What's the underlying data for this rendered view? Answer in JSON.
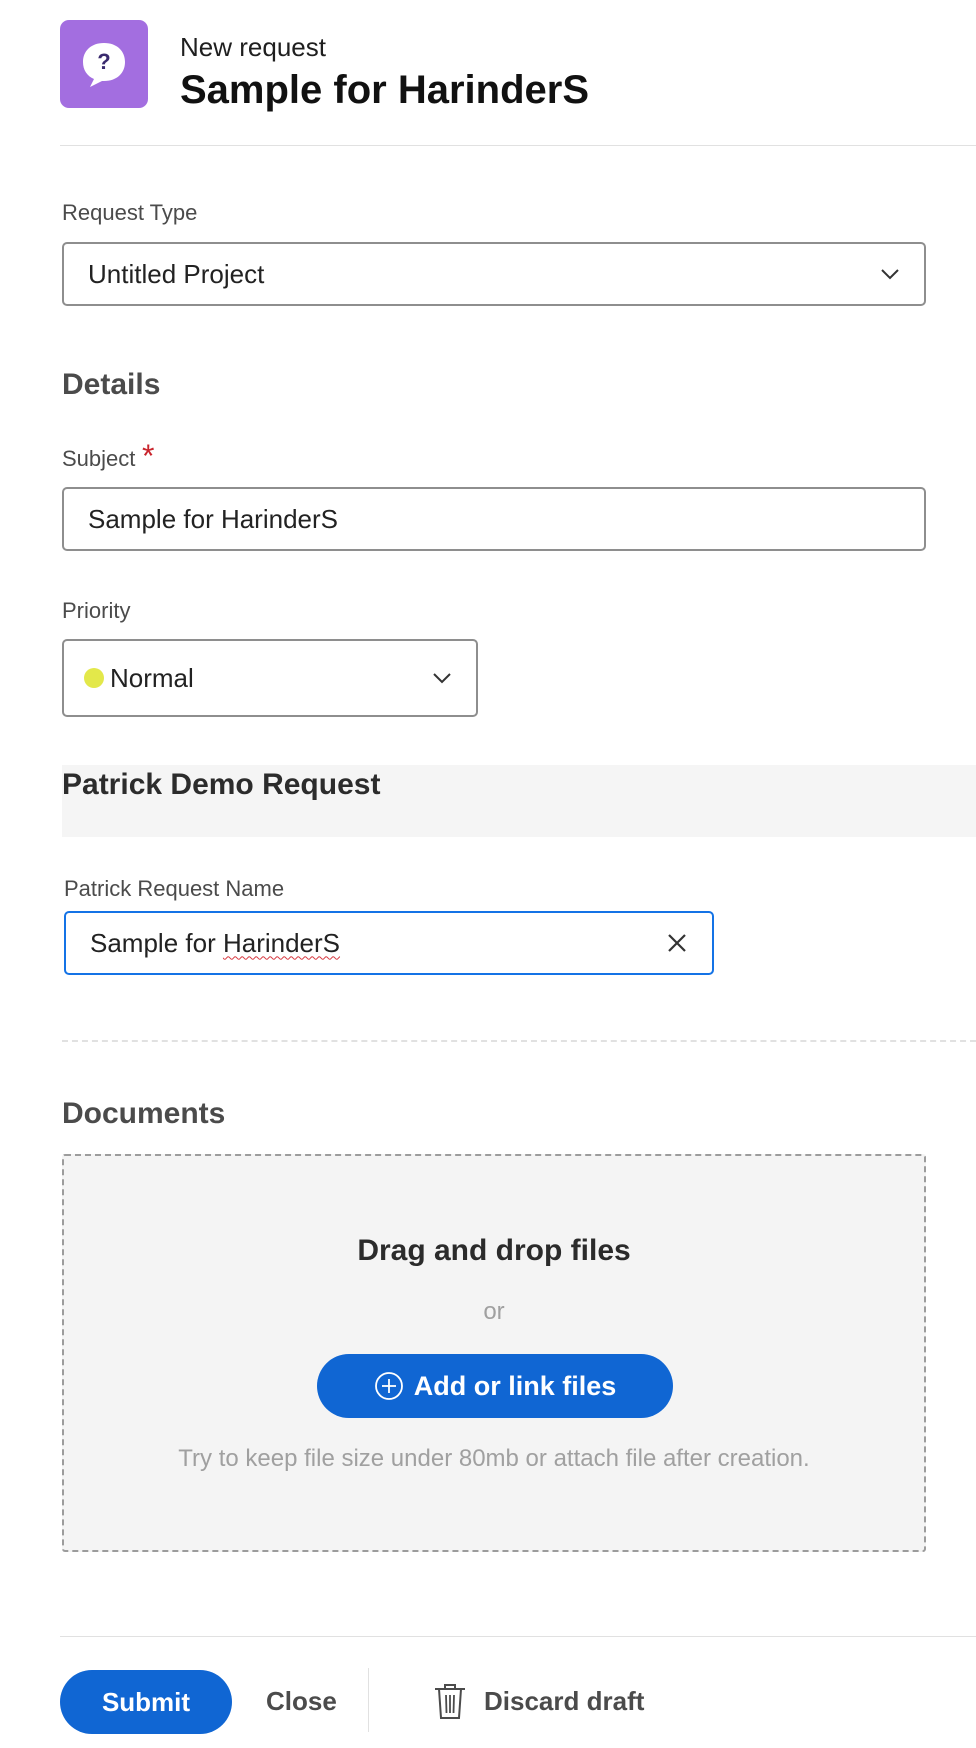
{
  "header": {
    "subtitle": "New request",
    "title": "Sample for HarinderS",
    "icon": "question-bubble-icon",
    "icon_color": "#a36ee0"
  },
  "request_type": {
    "label": "Request Type",
    "value": "Untitled Project"
  },
  "details": {
    "title": "Details",
    "subject_label": "Subject",
    "subject_required": "*",
    "subject_value": "Sample for HarinderS",
    "priority_label": "Priority",
    "priority_value": "Normal",
    "priority_color": "#e3e84a"
  },
  "custom_form": {
    "title": "Patrick Demo Request",
    "name_label": "Patrick Request Name",
    "name_value_prefix": "Sample for ",
    "name_value_misspelled": "HarinderS"
  },
  "documents": {
    "title": "Documents",
    "drop_title": "Drag and drop files",
    "or_text": "or",
    "add_button": "Add or link files",
    "hint": "Try to keep file size under 80mb or attach file after creation."
  },
  "footer": {
    "submit": "Submit",
    "close": "Close",
    "discard": "Discard draft"
  },
  "colors": {
    "accent": "#1066d3",
    "focus": "#1473e6",
    "required": "#c9252d"
  }
}
